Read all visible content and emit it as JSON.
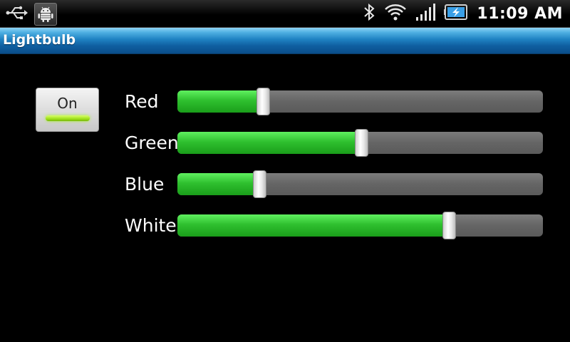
{
  "status_bar": {
    "time": "11:09 AM",
    "icons": [
      "usb-icon",
      "android-debug-icon",
      "bluetooth-icon",
      "wifi-icon",
      "signal-icon",
      "battery-charging-icon"
    ]
  },
  "app": {
    "title": "Lightbulb"
  },
  "toggle": {
    "label": "On",
    "state": true,
    "indicator_color": "#9ee01a"
  },
  "sliders": [
    {
      "label": "Red",
      "value": 0.235
    },
    {
      "label": "Green",
      "value": 0.504
    },
    {
      "label": "Blue",
      "value": 0.227
    },
    {
      "label": "White",
      "value": 0.744
    }
  ],
  "colors": {
    "title_bar": "#1f82c2",
    "slider_fill": "#2fc02f",
    "slider_track": "#656565",
    "background": "#000000"
  }
}
